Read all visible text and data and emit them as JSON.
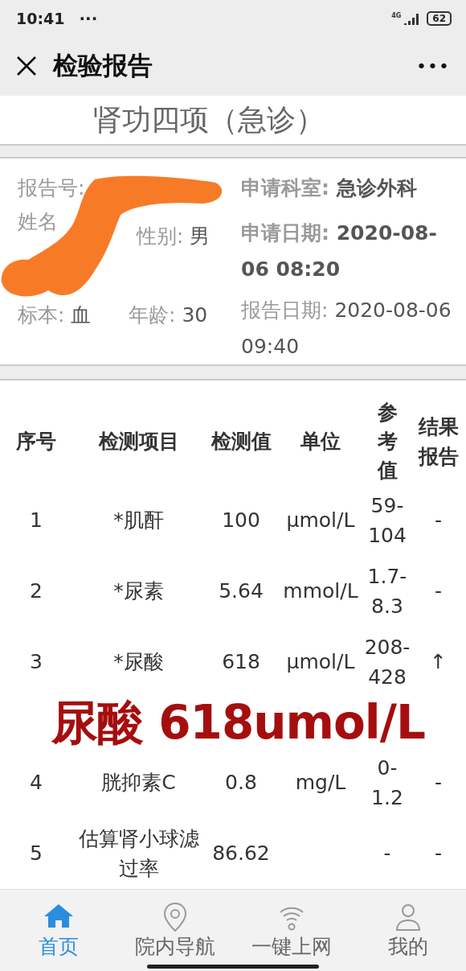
{
  "status_bar": {
    "time": "10:41",
    "more": "···",
    "network": "4G",
    "battery": "62"
  },
  "header": {
    "title": "检验报告",
    "more": "•••"
  },
  "report_title": "肾功四项（急诊）",
  "info": {
    "redacted": true,
    "report_no": {
      "label": "报告号:"
    },
    "name": {
      "label": "姓名"
    },
    "gender": {
      "label": "性别:",
      "value": "男"
    },
    "specimen": {
      "label": "标本:",
      "value": "血"
    },
    "age": {
      "label": "年龄:",
      "value": "30"
    },
    "department": {
      "label": "申请科室:",
      "value": "急诊外科",
      "emphasized": true
    },
    "request_date": {
      "label": "申请日期:",
      "value": "2020-08-06 08:20",
      "emphasized": true
    },
    "report_date": {
      "label": "报告日期:",
      "value": "2020-08-06 09:40",
      "emphasized": false
    }
  },
  "table": {
    "columns": [
      "序号",
      "检测项目",
      "检测值",
      "单位",
      "参考值",
      "结果报告"
    ],
    "rows": [
      [
        "1",
        "*肌酐",
        "100",
        "μmol/L",
        "59-104",
        "-"
      ],
      [
        "2",
        "*尿素",
        "5.64",
        "mmol/L",
        "1.7-8.3",
        "-"
      ],
      [
        "3",
        "*尿酸",
        "618",
        "μmol/L",
        "208-428",
        "↑"
      ],
      [
        "4",
        "胱抑素C",
        "0.8",
        "mg/L",
        "0-1.2",
        "-"
      ],
      [
        "5",
        "估算肾小球滤过率",
        "86.62",
        "",
        "-",
        "-"
      ]
    ]
  },
  "annotation": "尿酸 618umol/L",
  "bottom_nav": [
    {
      "label": "首页",
      "kind": "home",
      "selected": true
    },
    {
      "label": "院内导航",
      "kind": "pin",
      "selected": false
    },
    {
      "label": "一键上网",
      "kind": "wifi",
      "selected": false
    },
    {
      "label": "我的",
      "kind": "person",
      "selected": false
    }
  ]
}
